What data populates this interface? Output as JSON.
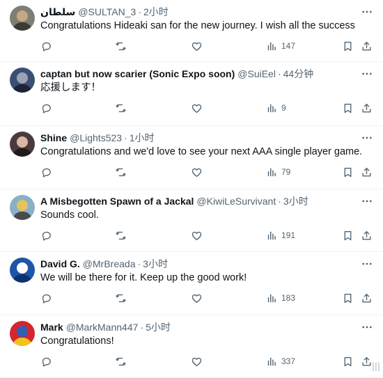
{
  "tweets": [
    {
      "name": "سلطان",
      "handle": "@SULTAN_3",
      "time": "2小时",
      "text": "Congratulations Hideaki san for the new journey. I wish all the success",
      "views": "147",
      "avatar_colors": [
        "#7d7f73",
        "#c8a884",
        "#3a3b35"
      ]
    },
    {
      "name": "captan but now scarier (Sonic Expo soon)",
      "handle": "@SuiEel",
      "time": "44分钟",
      "text": "応援します！",
      "views": "9",
      "avatar_colors": [
        "#3b4f74",
        "#9aa2b4",
        "#1d2335"
      ]
    },
    {
      "name": "Shine",
      "handle": "@Lights523",
      "time": "1小时",
      "text": "Congratulations and we'd love to see your next AAA single player game.",
      "views": "79",
      "avatar_colors": [
        "#4a3a3c",
        "#d9b7a3",
        "#1f1a1c"
      ]
    },
    {
      "name": "A Misbegotten Spawn of a Jackal",
      "handle": "@KiwiLeSurvivant",
      "time": "3小时",
      "text": "Sounds cool.",
      "views": "191",
      "avatar_colors": [
        "#8ab0c8",
        "#e3c45a",
        "#4a4a4a"
      ]
    },
    {
      "name": "David G.",
      "handle": "@MrBreada",
      "time": "3小时",
      "text": "We will be there for it. Keep up the good work!",
      "views": "183",
      "avatar_colors": [
        "#1d56a8",
        "#ffffff",
        "#0b3270"
      ]
    },
    {
      "name": "Mark",
      "handle": "@MarkMann447",
      "time": "5小时",
      "text": "Congratulations!",
      "views": "337",
      "avatar_colors": [
        "#d4262e",
        "#2f5fb7",
        "#f4c21d"
      ]
    }
  ],
  "separator": "·",
  "watermark": "|||"
}
